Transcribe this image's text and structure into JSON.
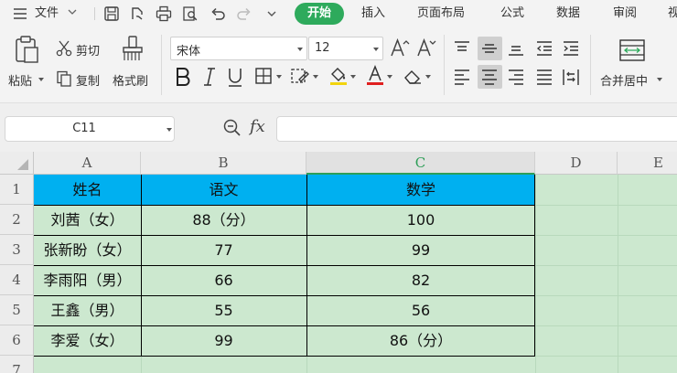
{
  "menubar": {
    "file_label": "文件",
    "tabs": [
      "开始",
      "插入",
      "页面布局",
      "公式",
      "数据",
      "审阅",
      "视"
    ]
  },
  "ribbon": {
    "paste_label": "粘贴",
    "cut_label": "剪切",
    "copy_label": "复制",
    "format_painter_label": "格式刷",
    "font_name": "宋体",
    "font_size": "12",
    "merge_center_label": "合并居中"
  },
  "formula_bar": {
    "cell_ref": "C11",
    "fx_label": "fx",
    "formula": ""
  },
  "sheet": {
    "columns": [
      "A",
      "B",
      "C",
      "D",
      "E"
    ],
    "active_column": "C",
    "rows": [
      "1",
      "2",
      "3",
      "4",
      "5",
      "6",
      "7"
    ],
    "cells": [
      [
        "姓名",
        "语文",
        "数学"
      ],
      [
        "刘茜（女）",
        "88（分）",
        "100"
      ],
      [
        "张新盼（女）",
        "77",
        "99"
      ],
      [
        "李雨阳（男）",
        "66",
        "82"
      ],
      [
        "王鑫（男）",
        "55",
        "56"
      ],
      [
        "李爱（女）",
        "99",
        "86（分）"
      ]
    ]
  },
  "colors": {
    "accent_green": "#2eaa5c",
    "header_fill": "#00b0f0",
    "sheet_bg": "#cce8cf"
  }
}
